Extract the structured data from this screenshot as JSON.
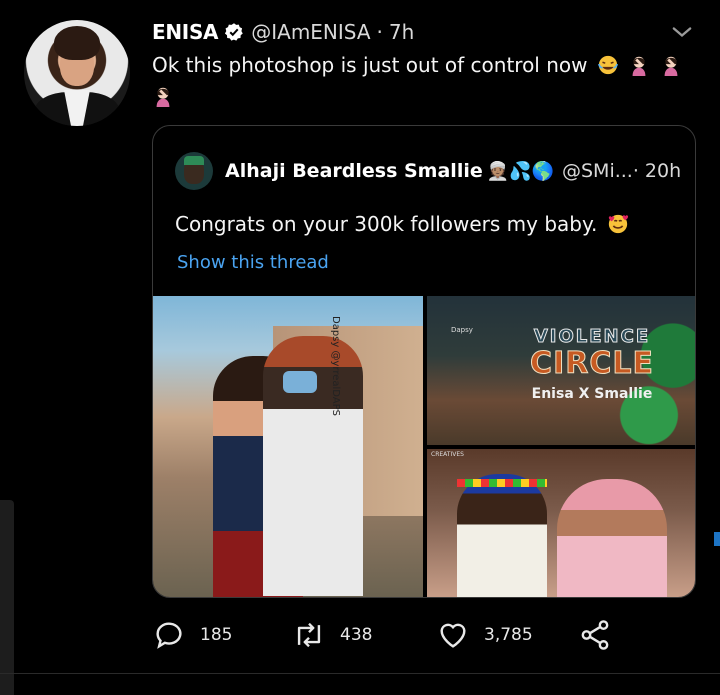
{
  "tweet": {
    "author_name": "ENISA",
    "author_handle": "@IAmENISA",
    "separator": "·",
    "time": "7h",
    "text": "Ok this photoshop is just out of control now",
    "text_emojis": [
      "face-with-tears-of-joy",
      "woman-facepalming",
      "woman-facepalming",
      "woman-facepalming"
    ]
  },
  "quote": {
    "author_name": "Alhaji Beardless Smallie",
    "author_emojis": "👳🏽💦🌎",
    "author_handle": "@SMi...",
    "time": "· 20h",
    "text": "Congrats on your 300k followers my baby.",
    "link": "Show this thread",
    "media": {
      "img1_tag": "Dapsy @yrrealDAPS",
      "img2_title": "VIOLENCE",
      "img2_subtitle": "CIRCLE",
      "img2_caption": "Enisa X Smallie",
      "img2_logo": "Dapsy",
      "img3_top": "CREATIVES"
    }
  },
  "actions": {
    "reply_count": "185",
    "retweet_count": "438",
    "like_count": "3,785"
  },
  "colors": {
    "background": "#000000",
    "link": "#4aa3f0",
    "verified": "#ffffff",
    "border": "#3a3a3a"
  }
}
